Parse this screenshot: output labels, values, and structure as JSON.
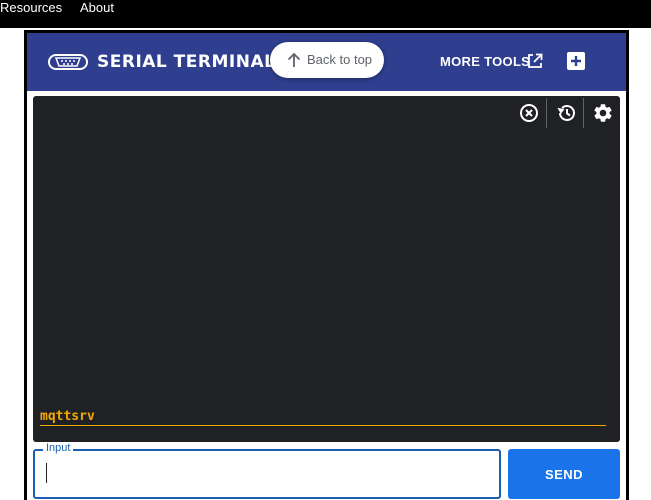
{
  "site_nav": {
    "items": [
      {
        "label": "Resources"
      },
      {
        "label": "About"
      }
    ]
  },
  "header": {
    "title": "SERIAL TERMINAL",
    "more_tools_label": "MORE TOOLS",
    "logo_icon": "serial-port-icon",
    "colors": {
      "header_bg": "#2f3e8f"
    }
  },
  "back_to_top": {
    "label": "Back to top"
  },
  "terminal": {
    "toolbar": {
      "clear_icon": "clear-icon",
      "history_icon": "history-icon",
      "settings_icon": "gear-icon"
    },
    "output_line": "mqttsrv",
    "colors": {
      "background": "#202124",
      "text": "#f6a800"
    }
  },
  "input": {
    "label": "Input",
    "value": "",
    "placeholder": ""
  },
  "send": {
    "label": "SEND",
    "color": "#1a73e8"
  }
}
